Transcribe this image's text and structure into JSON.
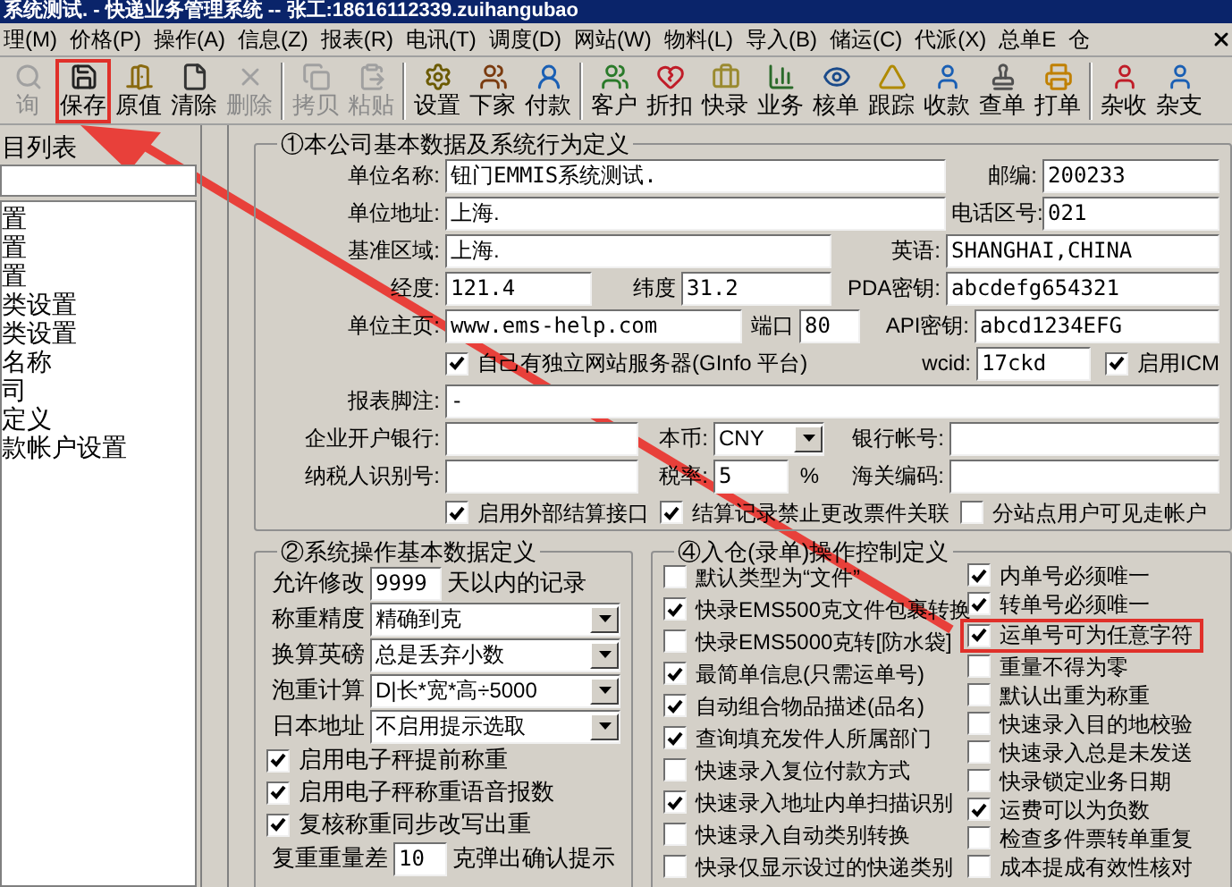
{
  "window": {
    "title": "系统测试. - 快递业务管理系统 -- 张工:18616112339.zuihangubao"
  },
  "menu": [
    "理(M)",
    "价格(P)",
    "操作(A)",
    "信息(Z)",
    "报表(R)",
    "电讯(T)",
    "调度(D)",
    "网站(W)",
    "物料(L)",
    "导入(B)",
    "储运(C)",
    "代派(X)",
    "总单E",
    "仓"
  ],
  "toolbar": [
    [
      {
        "label": "询",
        "disabled": true,
        "highlighted": false
      },
      {
        "label": "保存",
        "disabled": false,
        "highlighted": true
      },
      {
        "label": "原值",
        "disabled": false,
        "highlighted": false
      },
      {
        "label": "清除",
        "disabled": false,
        "highlighted": false
      },
      {
        "label": "删除",
        "disabled": true,
        "highlighted": false
      }
    ],
    [
      {
        "label": "拷贝",
        "disabled": true,
        "highlighted": false
      },
      {
        "label": "粘贴",
        "disabled": true,
        "highlighted": false
      }
    ],
    [
      {
        "label": "设置",
        "disabled": false,
        "highlighted": false
      },
      {
        "label": "下家",
        "disabled": false,
        "highlighted": false
      },
      {
        "label": "付款",
        "disabled": false,
        "highlighted": false
      }
    ],
    [
      {
        "label": "客户",
        "disabled": false,
        "highlighted": false
      },
      {
        "label": "折扣",
        "disabled": false,
        "highlighted": false
      },
      {
        "label": "快录",
        "disabled": false,
        "highlighted": false
      },
      {
        "label": "业务",
        "disabled": false,
        "highlighted": false
      },
      {
        "label": "核单",
        "disabled": false,
        "highlighted": false
      },
      {
        "label": "跟踪",
        "disabled": false,
        "highlighted": false
      },
      {
        "label": "收款",
        "disabled": false,
        "highlighted": false
      },
      {
        "label": "查单",
        "disabled": false,
        "highlighted": false
      },
      {
        "label": "打单",
        "disabled": false,
        "highlighted": false
      }
    ],
    [
      {
        "label": "杂收",
        "disabled": false,
        "highlighted": false
      },
      {
        "label": "杂支",
        "disabled": false,
        "highlighted": false
      }
    ]
  ],
  "sidebar": {
    "title": "目列表",
    "items": [
      "置",
      "置",
      "置",
      "类设置",
      "类设置",
      "名称",
      "司",
      "定义",
      "款帐户设置"
    ]
  },
  "company": {
    "title": "①本公司基本数据及系统行为定义",
    "name": {
      "label": "单位名称:",
      "value": "钮门EMMIS系统测试."
    },
    "postcode": {
      "label": "邮编:",
      "value": "200233"
    },
    "address": {
      "label": "单位地址:",
      "value": "上海."
    },
    "area_code": {
      "label": "电话区号:",
      "value": "021"
    },
    "region": {
      "label": "基准区域:",
      "value": "上海."
    },
    "english": {
      "label": "英语:",
      "value": "SHANGHAI,CHINA"
    },
    "longitude": {
      "label": "经度:",
      "value": "121.4"
    },
    "latitude": {
      "label": "纬度",
      "value": "31.2"
    },
    "pda_key": {
      "label": "PDA密钥:",
      "value": "abcdefg654321"
    },
    "homepage": {
      "label": "单位主页:",
      "value": "www.ems-help.com"
    },
    "port": {
      "label": "端口",
      "value": "80"
    },
    "api_key": {
      "label": "API密钥:",
      "value": "abcd1234EFG"
    },
    "own_server": {
      "label": "自己有独立网站服务器(GInfo 平台)",
      "checked": true
    },
    "wcid": {
      "label": "wcid:",
      "value": "17ckd"
    },
    "icm": {
      "label": "启用ICM",
      "checked": true
    },
    "report_footer": {
      "label": "报表脚注:",
      "value": "-"
    },
    "bank": {
      "label": "企业开户银行:"
    },
    "currency": {
      "label": "本币:",
      "value": "CNY"
    },
    "bank_account": {
      "label": "银行帐号:"
    },
    "tax_id": {
      "label": "纳税人识别号:"
    },
    "tax_rate": {
      "label": "税率:",
      "value": "5",
      "unit": "%"
    },
    "customs_code": {
      "label": "海关编码:"
    },
    "options": [
      {
        "label": "启用外部结算接口",
        "checked": true
      },
      {
        "label": "结算记录禁止更改票件关联",
        "checked": true
      },
      {
        "label": "分站点用户可见走帐户",
        "checked": false
      }
    ]
  },
  "system": {
    "title": "②系统操作基本数据定义",
    "edit_days": {
      "label": "允许修改",
      "value": "9999",
      "suffix": "天以内的记录"
    },
    "selects": [
      {
        "label": "称重精度",
        "value": "精确到克"
      },
      {
        "label": "换算英磅",
        "value": "总是丢弃小数"
      },
      {
        "label": "泡重计算",
        "value": "D|长*宽*高÷5000"
      },
      {
        "label": "日本地址",
        "value": "不启用提示选取"
      }
    ],
    "checks": [
      {
        "label": "启用电子秤提前称重",
        "checked": true
      },
      {
        "label": "启用电子秤称重语音报数",
        "checked": true
      },
      {
        "label": "复核称重同步改写出重",
        "checked": true
      }
    ],
    "weight_diff": {
      "label": "复重重量差",
      "value": "10",
      "suffix": "克弹出确认提示"
    }
  },
  "entry": {
    "title": "④入仓(录单)操作控制定义",
    "left": [
      {
        "label": "默认类型为“文件”",
        "checked": false,
        "highlighted": false
      },
      {
        "label": "快录EMS500克文件包裹转换",
        "checked": true,
        "highlighted": false
      },
      {
        "label": "快录EMS5000克转[防水袋]",
        "checked": false,
        "highlighted": false
      },
      {
        "label": "最简单信息(只需运单号)",
        "checked": true,
        "highlighted": false
      },
      {
        "label": "自动组合物品描述(品名)",
        "checked": true,
        "highlighted": false
      },
      {
        "label": "查询填充发件人所属部门",
        "checked": true,
        "highlighted": false
      },
      {
        "label": "快速录入复位付款方式",
        "checked": false,
        "highlighted": false
      },
      {
        "label": "快速录入地址内单扫描识别",
        "checked": true,
        "highlighted": false
      },
      {
        "label": "快速录入自动类别转换",
        "checked": false,
        "highlighted": false
      },
      {
        "label": "快录仅显示设过的快递类别",
        "checked": false,
        "highlighted": false
      }
    ],
    "right": [
      {
        "label": "内单号必须唯一",
        "checked": true,
        "highlighted": false
      },
      {
        "label": "转单号必须唯一",
        "checked": true,
        "highlighted": false
      },
      {
        "label": "运单号可为任意字符",
        "checked": true,
        "highlighted": true
      },
      {
        "label": "重量不得为零",
        "checked": false,
        "highlighted": false
      },
      {
        "label": "默认出重为称重",
        "checked": false,
        "highlighted": false
      },
      {
        "label": "快速录入目的地校验",
        "checked": false,
        "highlighted": false
      },
      {
        "label": "快速录入总是未发送",
        "checked": false,
        "highlighted": false
      },
      {
        "label": "快录锁定业务日期",
        "checked": false,
        "highlighted": false
      },
      {
        "label": "运费可以为负数",
        "checked": true,
        "highlighted": false
      },
      {
        "label": "检查多件票转单重复",
        "checked": false,
        "highlighted": false
      },
      {
        "label": "成本提成有效性核对",
        "checked": false,
        "highlighted": false
      }
    ]
  }
}
